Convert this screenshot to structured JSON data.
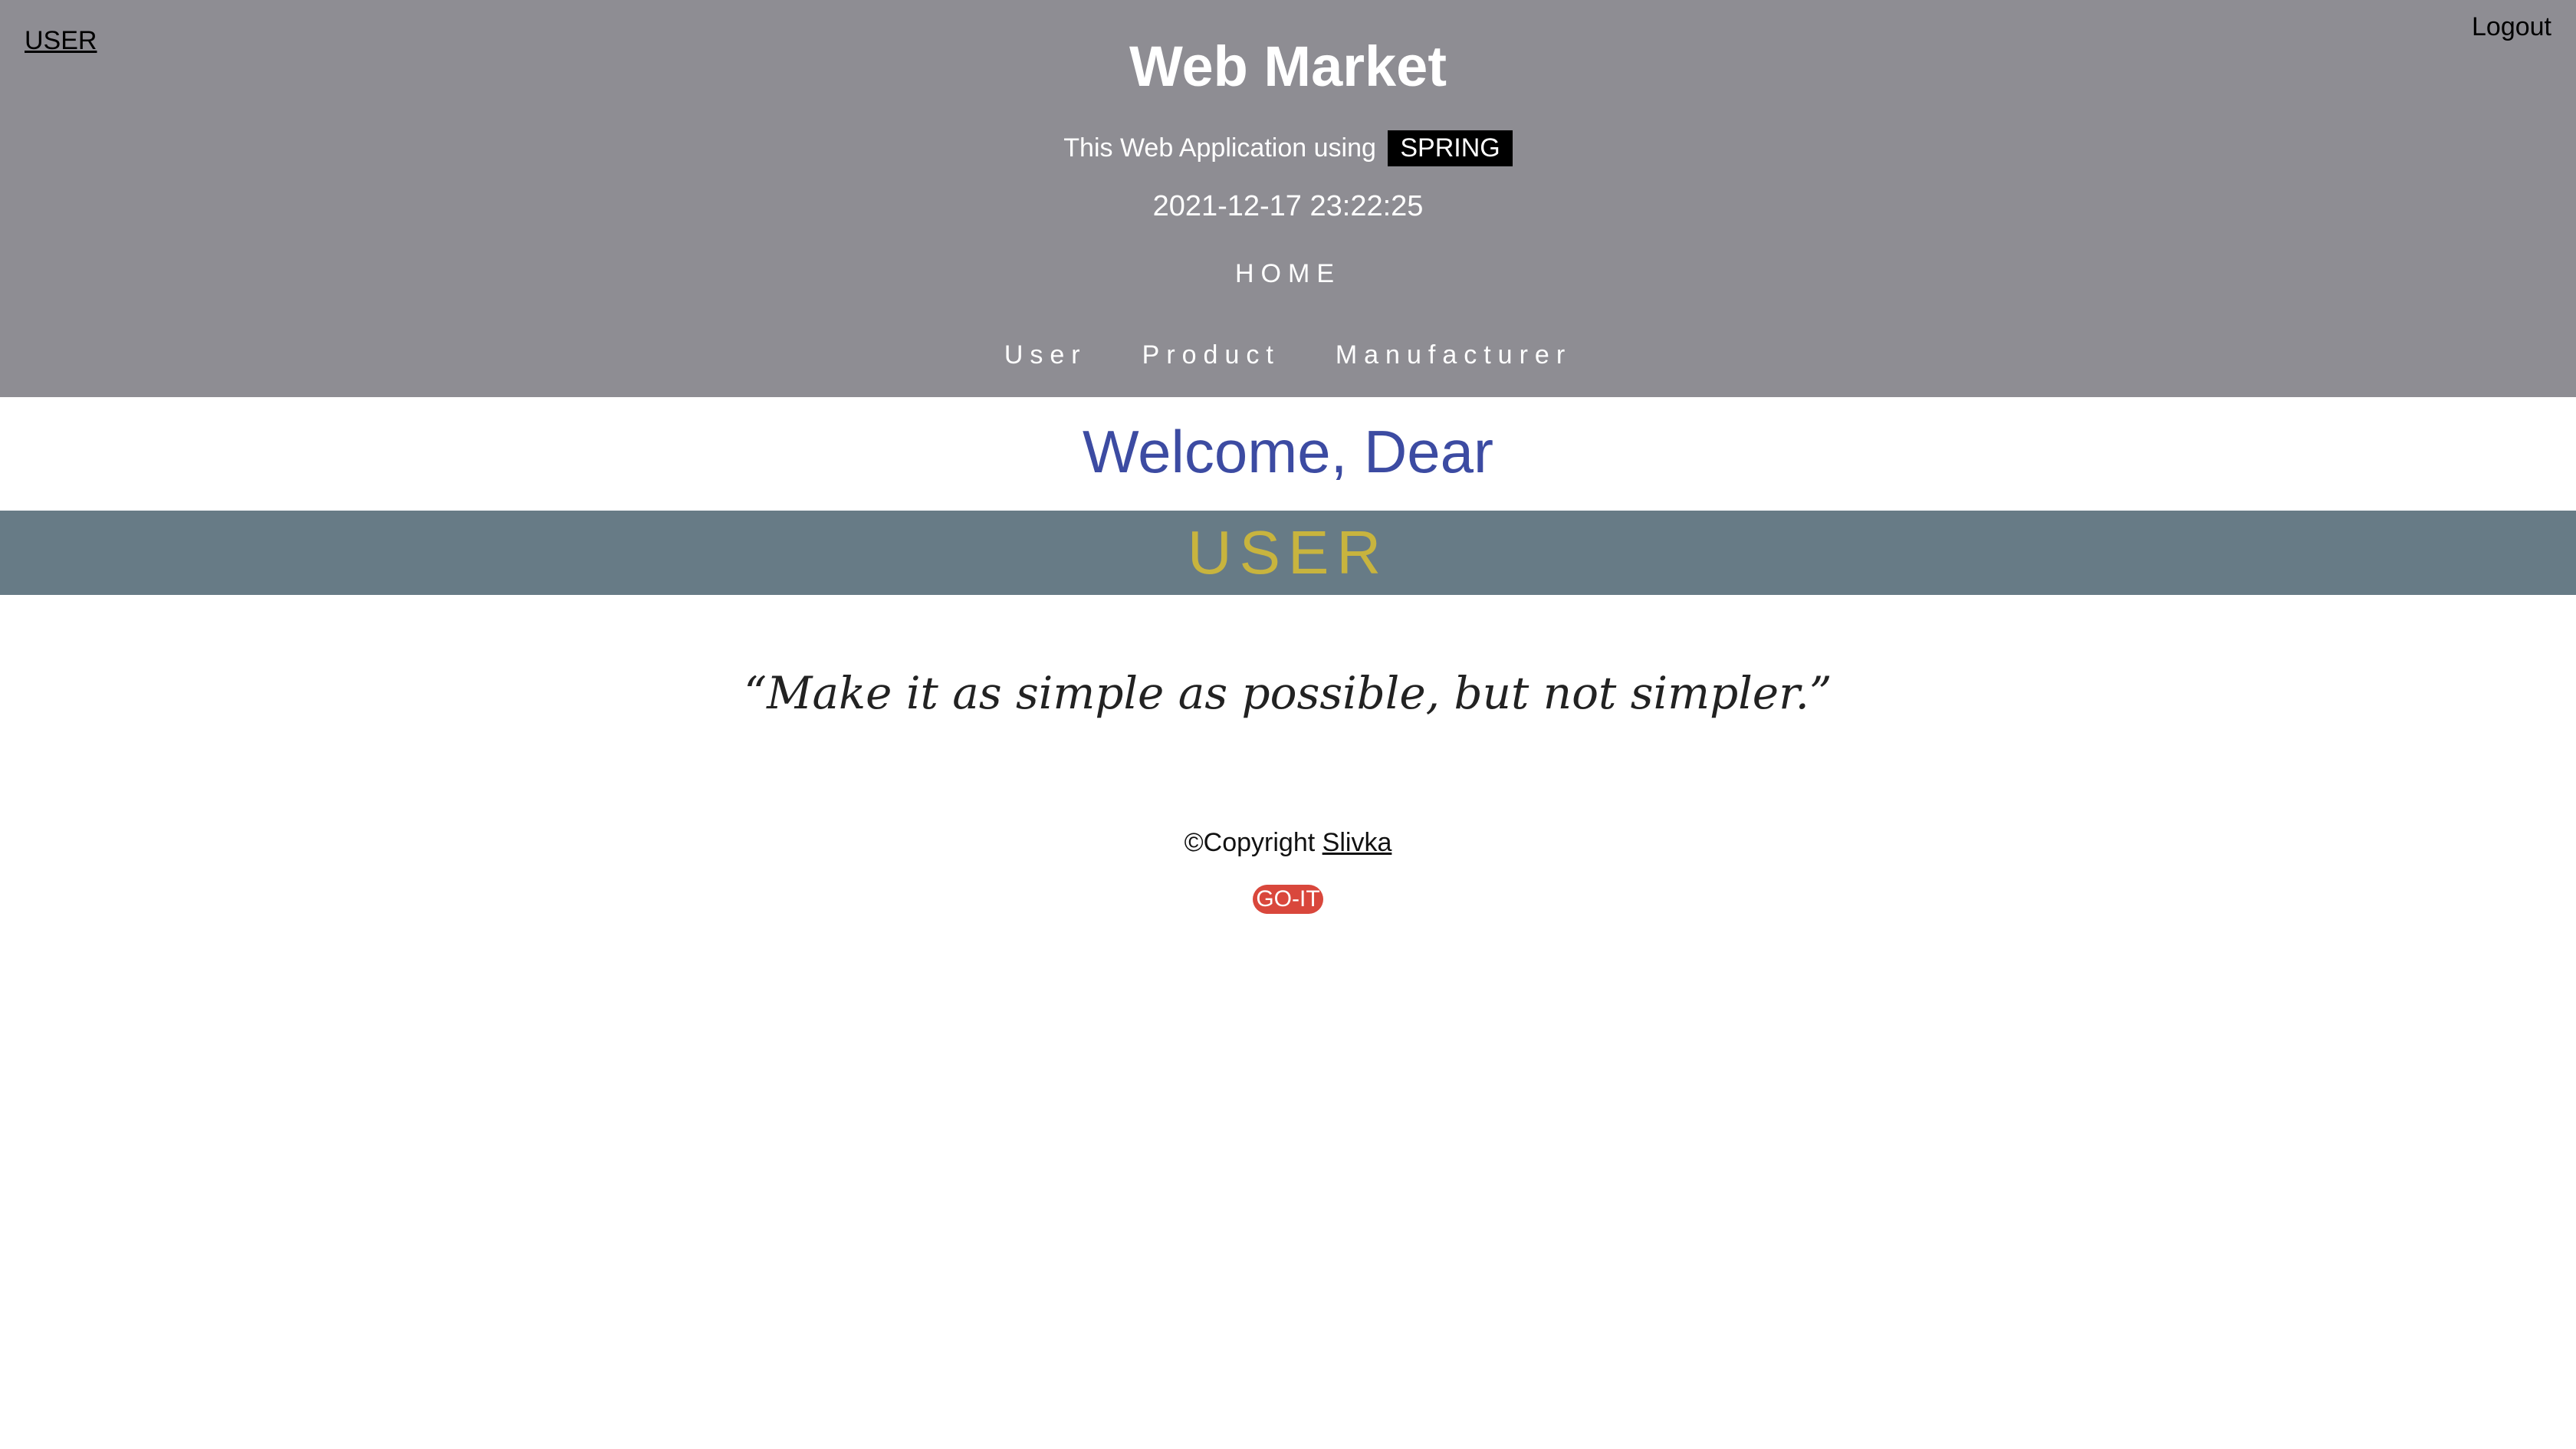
{
  "header": {
    "user_link": "USER",
    "logout_link": "Logout",
    "title": "Web Market",
    "tagline_text": "This Web Application using",
    "tagline_badge": "SPRING",
    "datetime": "2021-12-17 23:22:25",
    "home_link": "HOME",
    "nav": [
      "User",
      "Product",
      "Manufacturer"
    ],
    "background_color": "#8e8d93"
  },
  "main": {
    "welcome": "Welcome, Dear",
    "banner": "USER",
    "banner_color": "#677b86",
    "quote": "“Make it as simple as possible, but not simpler.”"
  },
  "footer": {
    "copyright_text": "©Copyright",
    "author": "Slivka",
    "badge": "GO-IT",
    "badge_color": "#d9473c"
  }
}
